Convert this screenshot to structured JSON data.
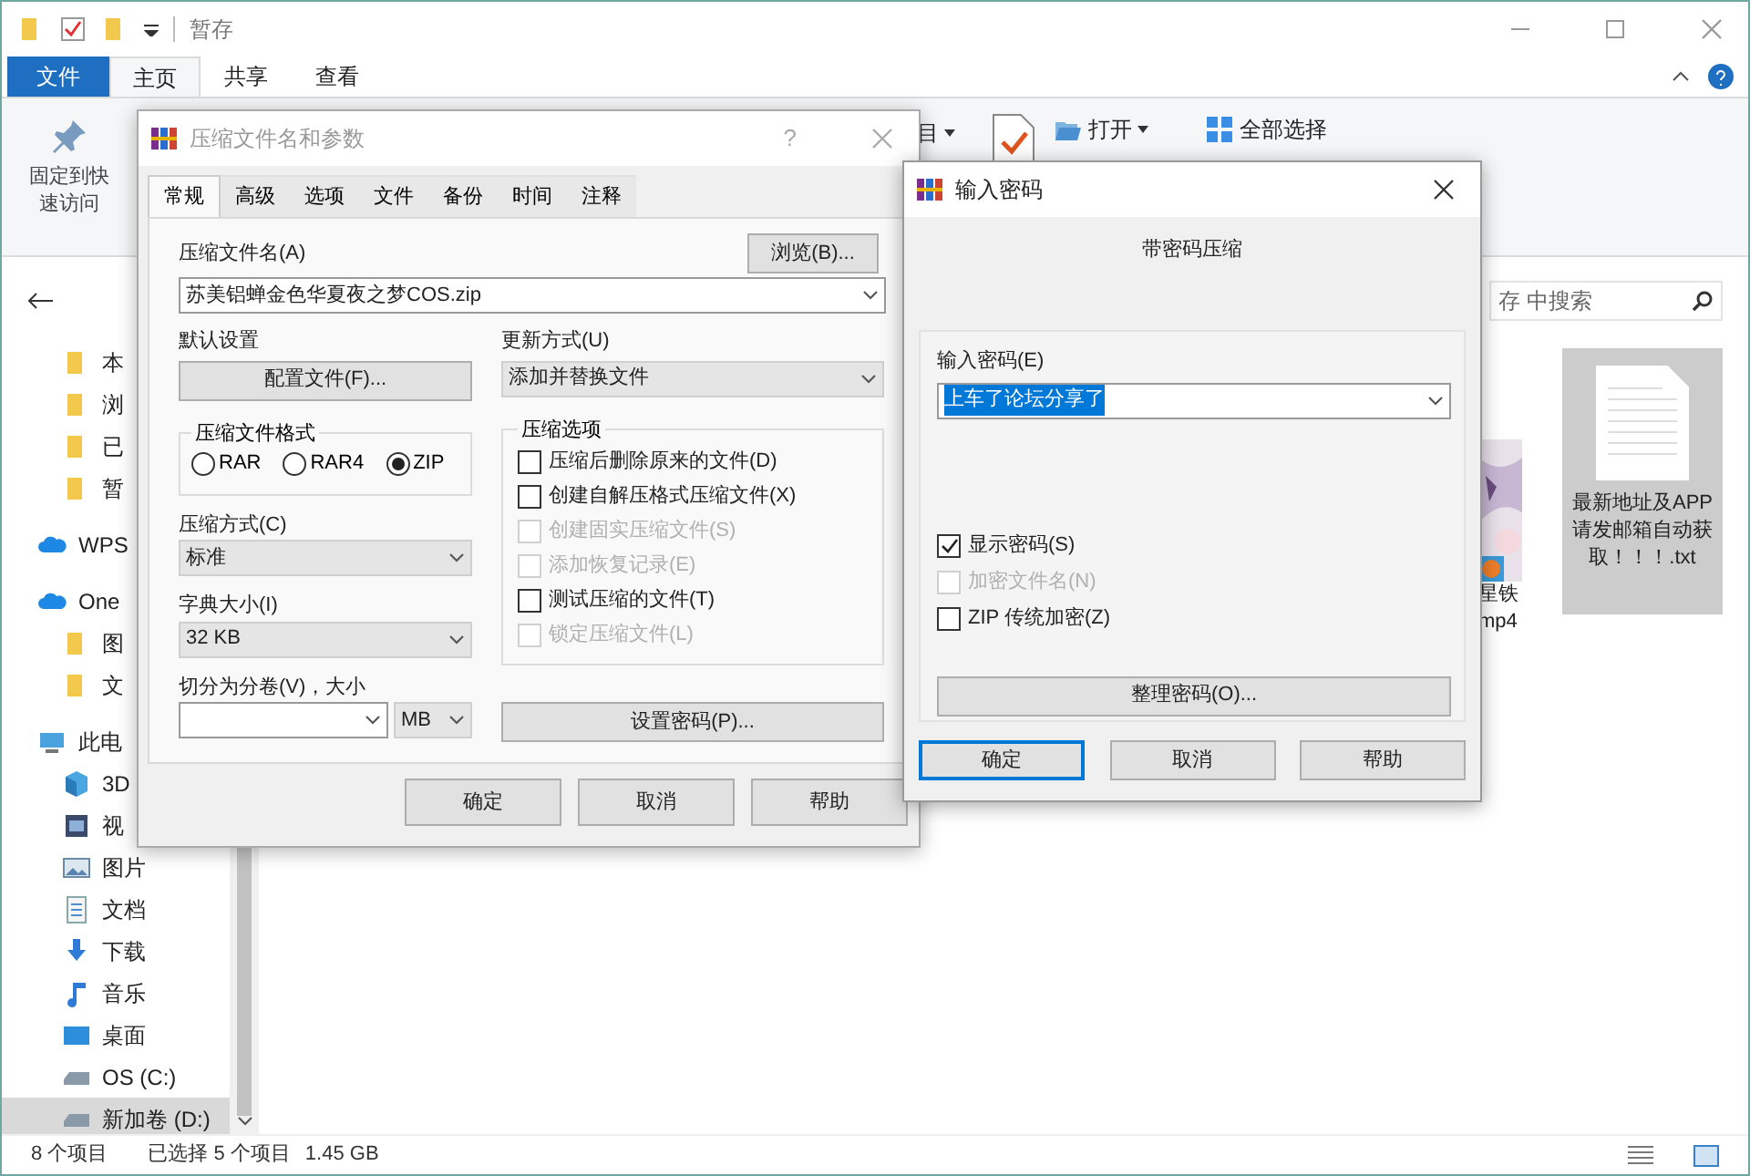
{
  "explorer": {
    "title": "暂存",
    "ribbon_tabs": [
      {
        "label": "文件",
        "kind": "file",
        "selected": false
      },
      {
        "label": "主页",
        "kind": "tab",
        "selected": true
      },
      {
        "label": "共享",
        "kind": "tab",
        "selected": false
      },
      {
        "label": "查看",
        "kind": "tab",
        "selected": false
      }
    ],
    "ribbon_items": [
      {
        "label": "固定到快速访问",
        "kind": "pin"
      },
      {
        "label": "目",
        "kind": "menu"
      },
      {
        "label": "打开",
        "kind": "open"
      },
      {
        "label": "全部选择",
        "kind": "select_all"
      }
    ],
    "search": {
      "placeholder": "存 中搜索"
    },
    "quick_access": [
      {
        "label": "本",
        "kind": "folder",
        "selected": false
      },
      {
        "label": "浏",
        "kind": "folder",
        "selected": false
      },
      {
        "label": "已",
        "kind": "folder",
        "selected": false
      },
      {
        "label": "暂",
        "kind": "folder",
        "selected": false
      }
    ],
    "nav": [
      {
        "label": "WPS",
        "kind": "cloud",
        "selected": false
      },
      {
        "label": "One",
        "kind": "cloud",
        "selected": false,
        "children": [
          {
            "label": "图",
            "kind": "folder",
            "selected": false
          },
          {
            "label": "文",
            "kind": "folder",
            "selected": false
          }
        ]
      },
      {
        "label": "此电",
        "kind": "pc",
        "selected": false,
        "children": [
          {
            "label": "3D",
            "kind": "cube",
            "selected": false
          },
          {
            "label": "视",
            "kind": "video",
            "selected": false
          },
          {
            "label": "图片",
            "kind": "picture",
            "selected": false
          },
          {
            "label": "文档",
            "kind": "doc",
            "selected": false
          },
          {
            "label": "下载",
            "kind": "download",
            "selected": false
          },
          {
            "label": "音乐",
            "kind": "music",
            "selected": false
          },
          {
            "label": "桌面",
            "kind": "desktop",
            "selected": false
          },
          {
            "label": "OS (C:)",
            "kind": "drive",
            "selected": false
          },
          {
            "label": "新加卷 (D:)",
            "kind": "drive",
            "selected": true
          }
        ]
      }
    ],
    "files": [
      {
        "name": "星铁 mp4",
        "kind": "video",
        "selected": false
      },
      {
        "name": "最新地址及APP请发邮箱自动获取！！！.txt",
        "kind": "text",
        "selected": true
      }
    ],
    "status": {
      "items": "8 个项目",
      "selection": "已选择 5 个项目",
      "size": "1.45 GB"
    }
  },
  "archive_dialog": {
    "title": "压缩文件名和参数",
    "help": "?",
    "tabs": [
      {
        "label": "常规",
        "selected": true
      },
      {
        "label": "高级",
        "selected": false
      },
      {
        "label": "选项",
        "selected": false
      },
      {
        "label": "文件",
        "selected": false
      },
      {
        "label": "备份",
        "selected": false
      },
      {
        "label": "时间",
        "selected": false
      },
      {
        "label": "注释",
        "selected": false
      }
    ],
    "archive_name": {
      "label": "压缩文件名(A)",
      "value": "苏美铝蝉金色华夏夜之梦COS.zip",
      "browse": "浏览(B)..."
    },
    "profiles": {
      "label": "默认设置",
      "button": "配置文件(F)..."
    },
    "update_mode": {
      "label": "更新方式(U)",
      "value": "添加并替换文件"
    },
    "format": {
      "label": "压缩文件格式",
      "options": [
        {
          "label": "RAR",
          "selected": false
        },
        {
          "label": "RAR4",
          "selected": false
        },
        {
          "label": "ZIP",
          "selected": true
        }
      ]
    },
    "method": {
      "label": "压缩方式(C)",
      "value": "标准"
    },
    "dictionary": {
      "label": "字典大小(I)",
      "value": "32 KB"
    },
    "split": {
      "label": "切分为分卷(V)，大小",
      "unit": "MB"
    },
    "options": {
      "label": "压缩选项",
      "items": [
        {
          "label": "压缩后删除原来的文件(D)",
          "checked": false,
          "disabled": false
        },
        {
          "label": "创建自解压格式压缩文件(X)",
          "checked": false,
          "disabled": false
        },
        {
          "label": "创建固实压缩文件(S)",
          "checked": false,
          "disabled": true
        },
        {
          "label": "添加恢复记录(E)",
          "checked": false,
          "disabled": true
        },
        {
          "label": "测试压缩的文件(T)",
          "checked": false,
          "disabled": false
        },
        {
          "label": "锁定压缩文件(L)",
          "checked": false,
          "disabled": true
        }
      ]
    },
    "set_password": "设置密码(P)...",
    "buttons": [
      {
        "label": "确定",
        "focused": false
      },
      {
        "label": "取消",
        "focused": false
      },
      {
        "label": "帮助",
        "focused": false
      }
    ]
  },
  "password_dialog": {
    "title": "输入密码",
    "subtitle": "带密码压缩",
    "password": {
      "label": "输入密码(E)",
      "value": "上车了论坛分享了",
      "highlighted": true
    },
    "options": [
      {
        "label": "显示密码(S)",
        "checked": true,
        "disabled": false
      },
      {
        "label": "加密文件名(N)",
        "checked": false,
        "disabled": true
      },
      {
        "label": "ZIP 传统加密(Z)",
        "checked": false,
        "disabled": false
      }
    ],
    "organize": "整理密码(O)...",
    "buttons": [
      {
        "label": "确定",
        "focused": true
      },
      {
        "label": "取消",
        "focused": false
      },
      {
        "label": "帮助",
        "focused": false
      }
    ]
  }
}
